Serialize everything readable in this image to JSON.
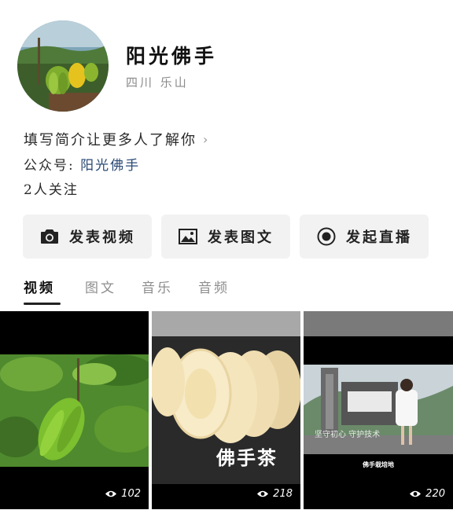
{
  "profile": {
    "name": "阳光佛手",
    "location": "四川 乐山",
    "bio_prompt": "填写简介让更多人了解你",
    "gzh_prefix": "公众号:",
    "gzh_name": "阳光佛手",
    "follow_text": "2人关注"
  },
  "actions": [
    {
      "label": "发表视频",
      "icon": "camera-icon"
    },
    {
      "label": "发表图文",
      "icon": "image-icon"
    },
    {
      "label": "发起直播",
      "icon": "live-icon"
    }
  ],
  "tabs": [
    {
      "label": "视频",
      "active": true
    },
    {
      "label": "图文",
      "active": false
    },
    {
      "label": "音乐",
      "active": false
    },
    {
      "label": "音频",
      "active": false
    }
  ],
  "videos": [
    {
      "views": "102",
      "overlay": ""
    },
    {
      "views": "218",
      "overlay": "佛手茶"
    },
    {
      "views": "220",
      "overlay": "佛手栽培地",
      "slogan": "坚守初心 守护技术"
    }
  ],
  "colors": {
    "accent_link": "#2a4a75",
    "button_bg": "#f2f2f2",
    "muted_text": "#8d8d8d"
  }
}
